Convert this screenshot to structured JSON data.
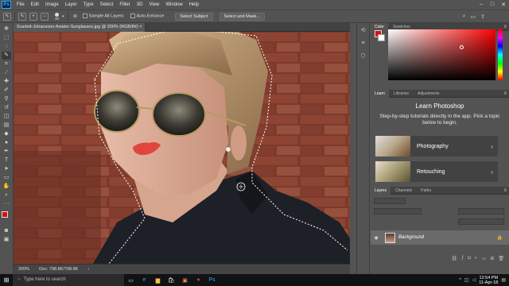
{
  "menubar": {
    "logo": "Ps",
    "items": [
      "File",
      "Edit",
      "Image",
      "Layer",
      "Type",
      "Select",
      "Filter",
      "3D",
      "View",
      "Window",
      "Help"
    ],
    "win_controls": [
      "–",
      "□",
      "✕"
    ]
  },
  "options_bar": {
    "brush_size": "30",
    "sample_all_layers": "Sample All Layers",
    "auto_enhance": "Auto-Enhance",
    "select_subject": "Select Subject",
    "select_and_mask": "Select and Mask..."
  },
  "document": {
    "tab_title": "Scarlett-Johansson-Aviator-Sunglasses.jpg @ 200% (RGB/8#)",
    "tab_close": "×",
    "zoom": "200%",
    "doc_size": "Doc: 798.8K/798.8K"
  },
  "color_panel": {
    "tabs": [
      "Color",
      "Swatches"
    ],
    "foreground": "#e00c0c",
    "background": "#ffffff"
  },
  "learn_panel": {
    "tabs": [
      "Learn",
      "Libraries",
      "Adjustments"
    ],
    "title": "Learn Photoshop",
    "description": "Step-by-step tutorials directly in the app. Pick a topic below to begin.",
    "cards": [
      {
        "label": "Photography"
      },
      {
        "label": "Retouching"
      }
    ]
  },
  "layers_panel": {
    "tabs": [
      "Layers",
      "Channels",
      "Paths"
    ],
    "layer_name": "Background"
  },
  "taskbar": {
    "search_placeholder": "Type here to search",
    "time": "12:54 PM",
    "date": "11-Apr-18"
  }
}
